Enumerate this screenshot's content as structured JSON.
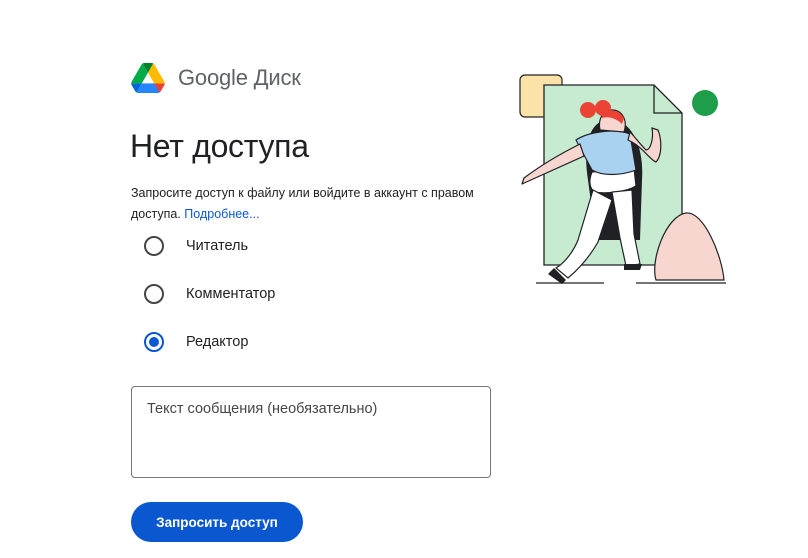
{
  "logo": {
    "text": "Google Диск",
    "icon": "google-drive-icon"
  },
  "title": "Нет доступа",
  "description": {
    "text": "Запросите доступ к файлу или войдите в аккаунт с правом доступа.",
    "link": "Подробнее..."
  },
  "roles": [
    {
      "label": "Читатель",
      "checked": false
    },
    {
      "label": "Комментатор",
      "checked": false
    },
    {
      "label": "Редактор",
      "checked": true
    }
  ],
  "message": {
    "placeholder": "Текст сообщения (необязательно)",
    "value": ""
  },
  "request_button": {
    "label": "Запросить доступ"
  },
  "colors": {
    "accent": "#0b57d0",
    "text": "#202124",
    "muted": "#5f6368",
    "illustration_green": "#c6ebd1",
    "illustration_yellow": "#fbe2a8",
    "illustration_pink": "#f7d6d0",
    "dot_green": "#1e9e4a",
    "hair_red": "#ea4335",
    "shirt_blue": "#a8d2f0"
  }
}
